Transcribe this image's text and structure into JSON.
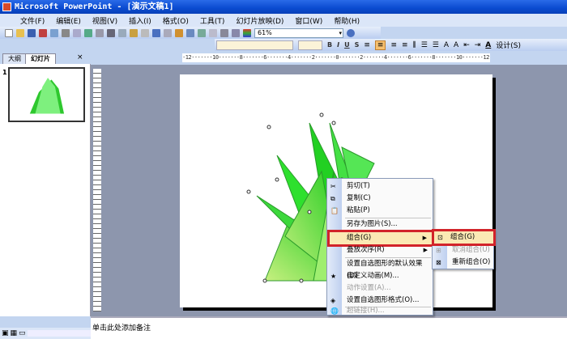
{
  "title": "Microsoft PowerPoint - [演示文稿1]",
  "menu": [
    "文件(F)",
    "编辑(E)",
    "视图(V)",
    "插入(I)",
    "格式(O)",
    "工具(T)",
    "幻灯片放映(D)",
    "窗口(W)",
    "帮助(H)"
  ],
  "toolbar": {
    "zoom": "61%",
    "design_label": "设计(S)"
  },
  "format_toolbar": [
    "B",
    "I",
    "U",
    "S"
  ],
  "tabs": [
    "大纲",
    "幻灯片"
  ],
  "slide_number": "1",
  "ruler_h": "·12·······10·······8·······6·······4·······2·······0·······2·······4·······6·······8·······10·······12·",
  "notes_placeholder": "单击此处添加备注",
  "context_menu": {
    "items": [
      {
        "label": "剪切(T)",
        "icon": "scissors-icon",
        "enabled": true
      },
      {
        "label": "复制(C)",
        "icon": "copy-icon",
        "enabled": true
      },
      {
        "label": "粘贴(P)",
        "icon": "paste-icon",
        "enabled": true
      },
      {
        "label": "另存为图片(S)...",
        "enabled": true
      },
      {
        "label": "组合(G)",
        "enabled": true,
        "submenu": true,
        "highlighted": true
      },
      {
        "label": "叠放次序(R)",
        "enabled": true,
        "submenu": true
      },
      {
        "label": "设置自选图形的默认效果(D)",
        "enabled": true
      },
      {
        "label": "自定义动画(M)...",
        "icon": "animation-icon",
        "enabled": true
      },
      {
        "label": "动作设置(A)...",
        "enabled": false
      },
      {
        "label": "设置自选图形格式(O)...",
        "icon": "format-shape-icon",
        "enabled": true
      },
      {
        "label": "超链接(H)...",
        "icon": "hyperlink-icon",
        "enabled": false
      }
    ]
  },
  "submenu": {
    "items": [
      {
        "label": "组合(G)",
        "icon": "group-icon",
        "enabled": true,
        "highlighted": true
      },
      {
        "label": "取消组合(U)",
        "icon": "ungroup-icon",
        "enabled": false
      },
      {
        "label": "重新组合(O)",
        "icon": "regroup-icon",
        "enabled": true
      }
    ]
  },
  "colors": {
    "accent": "#d2232a",
    "highlight": "#fbe9b4",
    "shape_green": "#33dd33",
    "canvas": "#8d96ad"
  }
}
